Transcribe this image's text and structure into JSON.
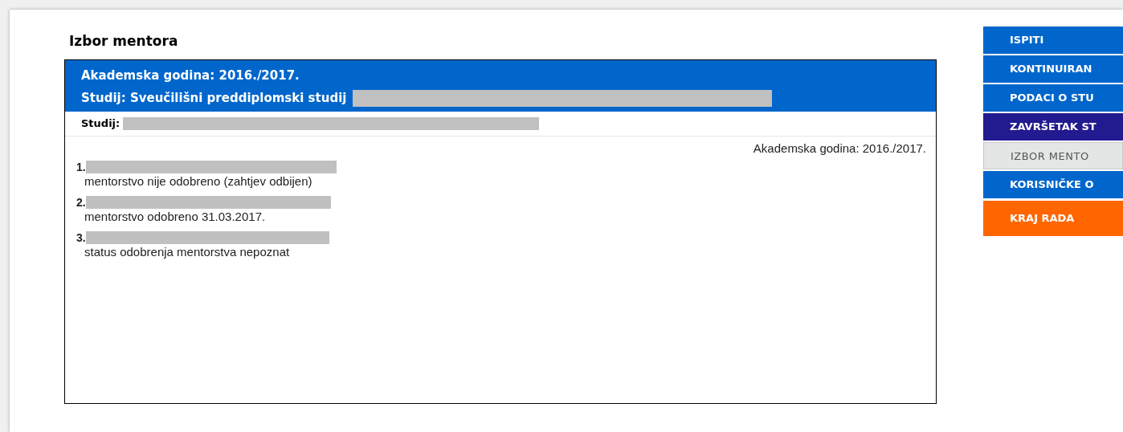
{
  "title": "Izbor mentora",
  "header": {
    "year": "Akademska godina: 2016./2017.",
    "study": "Studij: Sveučilišni preddiplomski studij"
  },
  "study_row": {
    "label": "Studij:"
  },
  "year_note": "Akademska godina: 2016./2017.",
  "mentors": [
    {
      "number": "1.",
      "status": "mentorstvo nije odobreno (zahtjev odbijen)"
    },
    {
      "number": "2.",
      "status": "mentorstvo odobreno 31.03.2017."
    },
    {
      "number": "3.",
      "status": "status odobrenja mentorstva nepoznat"
    }
  ],
  "menu": [
    {
      "label": "ISPITI",
      "color": "#0066cc",
      "selected": false
    },
    {
      "label": "KONTINUIRAN",
      "color": "#0066cc",
      "selected": false
    },
    {
      "label": "PODACI O STU",
      "color": "#0066cc",
      "selected": false
    },
    {
      "label": "ZAVRŠETAK ST",
      "color": "#221a8f",
      "selected": false
    },
    {
      "label": "IZBOR MENTO",
      "color": "#e4e6e6",
      "selected": true
    },
    {
      "label": "KORISNIČKE O",
      "color": "#0066cc",
      "selected": false
    },
    {
      "label": "KRAJ RADA",
      "color": "#ff6600",
      "selected": false
    }
  ]
}
